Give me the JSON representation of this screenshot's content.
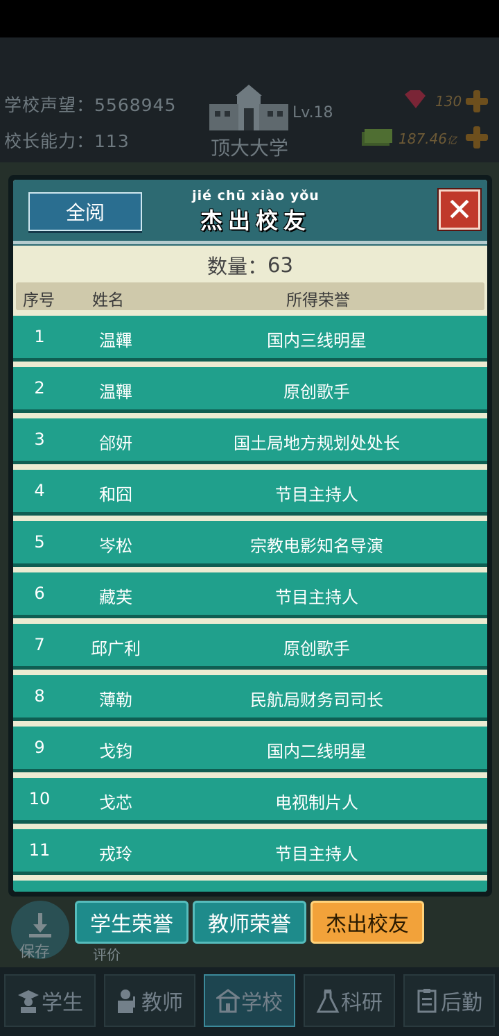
{
  "header": {
    "reputation_label": "学校声望：",
    "reputation_value": "5568945",
    "ability_label": "校长能力：",
    "ability_value": "113",
    "school_name": "顶大大学",
    "level": "Lv.18",
    "gems": "130",
    "money": "187.46",
    "money_unit": "亿"
  },
  "modal": {
    "view_all": "全阅",
    "title_pinyin": "jié chū xiào yǒu",
    "title": "杰出校友",
    "count_label": "数量：",
    "count_value": "63",
    "columns": {
      "no": "序号",
      "name": "姓名",
      "honor": "所得荣誉"
    },
    "rows": [
      {
        "no": "1",
        "name": "温鞸",
        "honor": "国内三线明星"
      },
      {
        "no": "2",
        "name": "温鞸",
        "honor": "原创歌手"
      },
      {
        "no": "3",
        "name": "郃妍",
        "honor": "国土局地方规划处处长"
      },
      {
        "no": "4",
        "name": "和囧",
        "honor": "节目主持人"
      },
      {
        "no": "5",
        "name": "岑松",
        "honor": "宗教电影知名导演"
      },
      {
        "no": "6",
        "name": "藏芙",
        "honor": "节目主持人"
      },
      {
        "no": "7",
        "name": "邱广利",
        "honor": "原创歌手"
      },
      {
        "no": "8",
        "name": "薄勒",
        "honor": "民航局财务司司长"
      },
      {
        "no": "9",
        "name": "戈钧",
        "honor": "国内二线明星"
      },
      {
        "no": "10",
        "name": "戈芯",
        "honor": "电视制片人"
      },
      {
        "no": "11",
        "name": "戎玲",
        "honor": "节目主持人"
      }
    ]
  },
  "tabs": {
    "student": "学生荣誉",
    "teacher": "教师荣誉",
    "alumni": "杰出校友"
  },
  "save_label": "保存",
  "eval_label": "评价",
  "nav": {
    "student": "学生",
    "teacher": "教师",
    "school": "学校",
    "research": "科研",
    "logistics": "后勤"
  },
  "colors": {
    "row": "#20a08c",
    "header": "#2d6a72",
    "close": "#c0392b",
    "active_tab": "#f2a23a"
  }
}
